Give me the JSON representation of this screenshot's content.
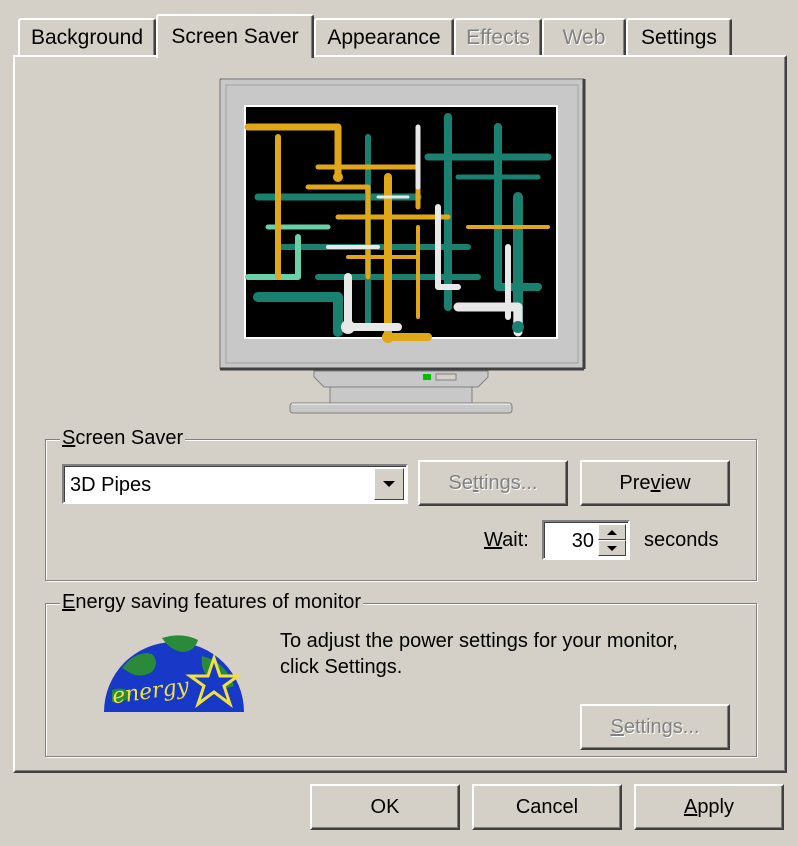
{
  "tabs": [
    {
      "label": "Background",
      "state": "normal"
    },
    {
      "label": "Screen Saver",
      "state": "active"
    },
    {
      "label": "Appearance",
      "state": "normal"
    },
    {
      "label": "Effects",
      "state": "disabled"
    },
    {
      "label": "Web",
      "state": "disabled"
    },
    {
      "label": "Settings",
      "state": "normal"
    }
  ],
  "screen_saver": {
    "group_label_key": "S",
    "group_label_rest": "creen Saver",
    "selected": "3D Pipes",
    "settings_button": {
      "prefix": "Se",
      "key": "t",
      "rest": "tings..."
    },
    "preview_button": {
      "prefix": "Pre",
      "key": "v",
      "rest": "iew"
    },
    "wait_label_key": "W",
    "wait_label_rest": "ait:",
    "wait_value": "30",
    "wait_unit": "seconds"
  },
  "energy": {
    "group_label_key": "E",
    "group_label_rest": "nergy saving features of monitor",
    "description_line1": "To adjust the power settings for your monitor,",
    "description_line2": "click Settings.",
    "settings_button": {
      "key": "S",
      "rest": "ettings..."
    },
    "logo_text": "energy"
  },
  "footer": {
    "ok_label": "OK",
    "cancel_label": "Cancel",
    "apply_key": "A",
    "apply_rest": "pply"
  },
  "colors": {
    "face": "#d4d0c8",
    "pipe_yellow": "#e0a818",
    "pipe_teal": "#1a8070",
    "pipe_white": "#e8e8e8",
    "globe_blue": "#1838c8",
    "globe_green": "#2a8a3a"
  }
}
